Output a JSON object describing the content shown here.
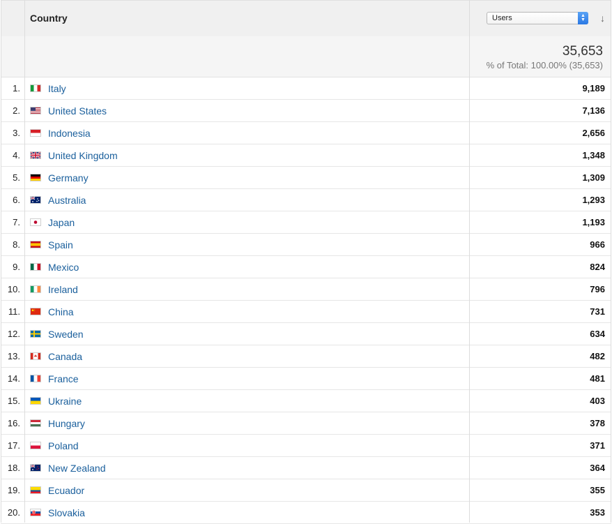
{
  "header": {
    "dimension_label": "Country",
    "metric_selected": "Users",
    "sort_icon": "arrow-down-icon"
  },
  "totals": {
    "value": "35,653",
    "percent_text": "% of Total: 100.00% (35,653)"
  },
  "rows": [
    {
      "rank": "1.",
      "country": "Italy",
      "users": "9,189",
      "flag": [
        "#159a3b",
        "#ffffff",
        "#d52b2b"
      ],
      "flag_dir": "v"
    },
    {
      "rank": "2.",
      "country": "United States",
      "users": "7,136",
      "flag": "us"
    },
    {
      "rank": "3.",
      "country": "Indonesia",
      "users": "2,656",
      "flag": [
        "#d61f26",
        "#ffffff"
      ],
      "flag_dir": "h"
    },
    {
      "rank": "4.",
      "country": "United Kingdom",
      "users": "1,348",
      "flag": "uk"
    },
    {
      "rank": "5.",
      "country": "Germany",
      "users": "1,309",
      "flag": [
        "#000000",
        "#dd0000",
        "#ffce00"
      ],
      "flag_dir": "h"
    },
    {
      "rank": "6.",
      "country": "Australia",
      "users": "1,293",
      "flag": "au"
    },
    {
      "rank": "7.",
      "country": "Japan",
      "users": "1,193",
      "flag": "jp"
    },
    {
      "rank": "8.",
      "country": "Spain",
      "users": "966",
      "flag": [
        "#c60b1e",
        "#ffc400",
        "#ffc400",
        "#c60b1e"
      ],
      "flag_dir": "h"
    },
    {
      "rank": "9.",
      "country": "Mexico",
      "users": "824",
      "flag": [
        "#006847",
        "#ffffff",
        "#ce1126"
      ],
      "flag_dir": "v"
    },
    {
      "rank": "10.",
      "country": "Ireland",
      "users": "796",
      "flag": [
        "#169b62",
        "#ffffff",
        "#ff883e"
      ],
      "flag_dir": "v"
    },
    {
      "rank": "11.",
      "country": "China",
      "users": "731",
      "flag": "cn"
    },
    {
      "rank": "12.",
      "country": "Sweden",
      "users": "634",
      "flag": "se"
    },
    {
      "rank": "13.",
      "country": "Canada",
      "users": "482",
      "flag": "ca"
    },
    {
      "rank": "14.",
      "country": "France",
      "users": "481",
      "flag": [
        "#0055a4",
        "#ffffff",
        "#ef4135"
      ],
      "flag_dir": "v"
    },
    {
      "rank": "15.",
      "country": "Ukraine",
      "users": "403",
      "flag": [
        "#0057b7",
        "#ffd700"
      ],
      "flag_dir": "h"
    },
    {
      "rank": "16.",
      "country": "Hungary",
      "users": "378",
      "flag": [
        "#ce2939",
        "#ffffff",
        "#477050"
      ],
      "flag_dir": "h"
    },
    {
      "rank": "17.",
      "country": "Poland",
      "users": "371",
      "flag": [
        "#ffffff",
        "#dc143c"
      ],
      "flag_dir": "h"
    },
    {
      "rank": "18.",
      "country": "New Zealand",
      "users": "364",
      "flag": "nz"
    },
    {
      "rank": "19.",
      "country": "Ecuador",
      "users": "355",
      "flag": [
        "#ffdd00",
        "#ffdd00",
        "#034ea2",
        "#ed1c24"
      ],
      "flag_dir": "h"
    },
    {
      "rank": "20.",
      "country": "Slovakia",
      "users": "353",
      "flag": "sk"
    }
  ]
}
